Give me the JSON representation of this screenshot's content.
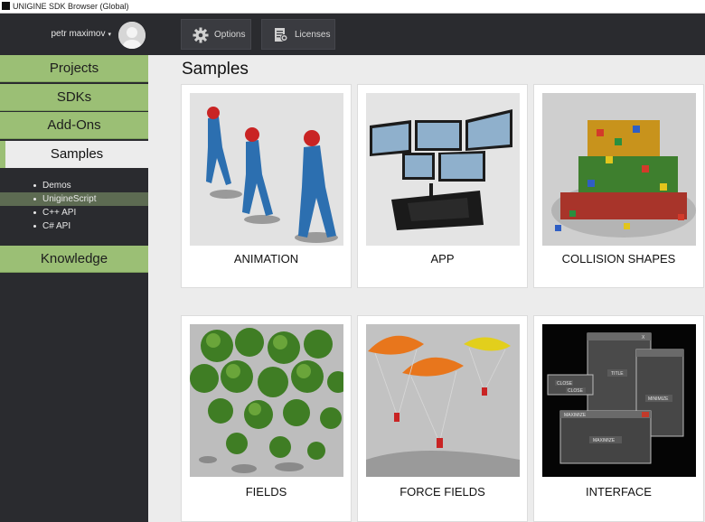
{
  "window": {
    "title": "UNIGINE SDK Browser (Global)"
  },
  "header": {
    "user_name": "petr maximov",
    "caret": "▾",
    "options_label": "Options",
    "licenses_label": "Licenses"
  },
  "sidebar": {
    "items": [
      {
        "label": "Projects"
      },
      {
        "label": "SDKs"
      },
      {
        "label": "Add-Ons"
      },
      {
        "label": "Samples"
      },
      {
        "label": "Knowledge"
      }
    ],
    "subitems": [
      {
        "label": "Demos"
      },
      {
        "label": "UnigineScript"
      },
      {
        "label": "C++ API"
      },
      {
        "label": "C# API"
      }
    ]
  },
  "main": {
    "title": "Samples",
    "cards": [
      {
        "label": "ANIMATION"
      },
      {
        "label": "APP"
      },
      {
        "label": "COLLISION SHAPES"
      },
      {
        "label": "FIELDS"
      },
      {
        "label": "FORCE FIELDS"
      },
      {
        "label": "INTERFACE"
      }
    ],
    "interface_thumb": {
      "close1": "CLOSE",
      "close2": "CLOSE",
      "title": "TITLE",
      "minimize": "MINIMIZE",
      "maximize1": "MAXIMIZE",
      "maximize2": "MAXIMIZE",
      "x": "X",
      "app": "OCULUS"
    }
  },
  "colors": {
    "accent": "#9bbf75",
    "dark": "#2a2b2f",
    "background": "#ececec"
  }
}
